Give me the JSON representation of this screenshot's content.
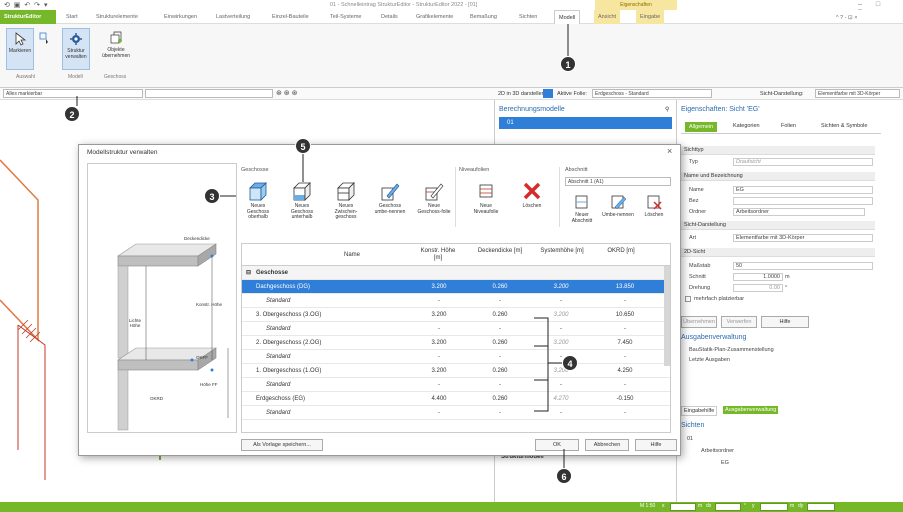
{
  "titlebar": {
    "quick_access": "⟲ ▣ ↶ ↷ ▾",
    "title": "01 - Schnelleintrag StrukturEditor - StrukturEditor 2022 - [01]",
    "context": "Eigenschaften",
    "win": "– □ ×",
    "help": "^ ? - ⊡ ×"
  },
  "tabs": {
    "app": "StrukturEditor",
    "start": "Start",
    "struktur": "Strukturelemente",
    "einwirk": "Einwirkungen",
    "last": "Lastverteilung",
    "einzel": "Einzel-Bauteile",
    "teil": "Teil-Systeme",
    "details": "Details",
    "grafik": "Grafikelemente",
    "bemassung": "Bemaßung",
    "sichten": "Sichten",
    "modell": "Modell",
    "ansicht": "Ansicht",
    "eingabe": "Eingabe"
  },
  "ribbon": {
    "markieren": "Markieren",
    "struktur": "Struktur verwalten",
    "objekte": "Objekte übernehmen",
    "g_auswahl": "Auswahl",
    "g_modell": "Modell",
    "g_geschoss": "Geschoss"
  },
  "toolbar": {
    "filter": "Alles markierbar",
    "show3d": "2D in 3D darstellen:",
    "aktive": "Aktive Folie:",
    "folie": "Erdgeschoss - Standard",
    "sichtdar": "Sicht-Darstellung:",
    "sichtwert": "Elementfarbe mit 3D-Körper"
  },
  "calc": {
    "title": "Berechnungsmodelle",
    "item": "01",
    "strukturmodell": "Strukturmodell"
  },
  "props": {
    "title": "Eigenschaften: Sicht 'EG'",
    "tab_allg": "Allgemein",
    "tab_kat": "Kategorien",
    "tab_fol": "Folien",
    "tab_sym": "Sichten & Symbole",
    "s_typ": "Sichttyp",
    "typ_l": "Typ",
    "typ_v": "Draufsicht",
    "s_name": "Name und Bezeichnung",
    "name_l": "Name",
    "name_v": "EG",
    "bez_l": "Bez",
    "ordner_l": "Ordner",
    "ordner_v": "Arbeitsordner",
    "s_sicht": "Sicht-Darstellung",
    "art_l": "Art",
    "art_v": "Elementfarbe mit 3D-Körper",
    "s_2d": "2D-Sicht",
    "mass_l": "Maßstab",
    "mass_v": "50",
    "schnitt_l": "Schnitt",
    "schnitt_v": "1.0000",
    "schnitt_u": "m",
    "dreh_l": "Drehung",
    "dreh_v": "0.00",
    "dreh_u": "°",
    "platz": "mehrfach platzierbar",
    "btn_ueber": "Übernehmen",
    "btn_verw": "Verwerfen",
    "btn_hilfe": "Hilfe",
    "ausgabe_title": "Ausgabenverwaltung",
    "ausgabe_1": "BauStatik-Plan-Zusammenstellung",
    "ausgabe_2": "Letzte Ausgaben",
    "tab_eingabehilfe": "Eingabehilfe",
    "tab_ausgabe": "Ausgabenverwaltung",
    "sichten_title": "Sichten",
    "tree_01": "01",
    "tree_ordner": "Arbeitsordner",
    "tree_eg": "EG"
  },
  "status": {
    "scale": "M 1:50",
    "x_l": "x",
    "x_v": "2.8572",
    "dx_l": "m",
    "dx": "dx",
    "dx_v": "106.45",
    "ang": "°",
    "y_l": "y",
    "y_v": "-0.0091",
    "dy": "dy",
    "dy_v": "2.7403",
    "m2": "m",
    "m3": "m"
  },
  "dialog": {
    "title": "Modellstruktur verwalten",
    "g_geschosse": "Geschosse",
    "g_niveau": "Niveaufolien",
    "g_abschnitt": "Abschnitt",
    "abschnitt_sel": "Abschnitt 1 (A1)",
    "b_oberhalb": "Neues Geschoss oberhalb",
    "b_unterhalb": "Neues Geschoss unterhalb",
    "b_zwischen": "Neues Zwischen-geschoss",
    "b_umbenennen": "Geschoss umbe-nennen",
    "b_folie": "Neue Geschoss-folie",
    "b_niveau": "Neue Niveaufolie",
    "b_loeschen": "Löschen",
    "b_abschnitt": "Neuer Abschnitt",
    "b_umbenennen2": "Umbe-nennen",
    "b_loeschen2": "Löschen",
    "d_deckendicke": "Deckendicke",
    "d_konstr": "Konstr. Höhe",
    "d_lichte": "Lichte Höhe",
    "d_okff": "OKFF",
    "d_hoheff": "Höhe FF",
    "d_okrd": "OKRD",
    "h_name": "Name",
    "h_konstr": "Konstr. Höhe [m]",
    "h_decken": "Deckendicke [m]",
    "h_system": "Systemhöhe [m]",
    "h_okrd": "OKRD [m]",
    "group": "Geschosse",
    "rows": [
      {
        "name": "Dachgeschoss (DG)",
        "k": "3.200",
        "d": "0.260",
        "s": "3.200",
        "o": "13.850"
      },
      {
        "name": "Standard",
        "k": "-",
        "d": "-",
        "s": "-",
        "o": "-"
      },
      {
        "name": "3. Obergeschoss (3.OG)",
        "k": "3.200",
        "d": "0.260",
        "s": "3.200",
        "o": "10.650"
      },
      {
        "name": "Standard",
        "k": "-",
        "d": "-",
        "s": "-",
        "o": "-"
      },
      {
        "name": "2. Obergeschoss (2.OG)",
        "k": "3.200",
        "d": "0.260",
        "s": "3.200",
        "o": "7.450"
      },
      {
        "name": "Standard",
        "k": "-",
        "d": "-",
        "s": "-",
        "o": "-"
      },
      {
        "name": "1. Obergeschoss (1.OG)",
        "k": "3.200",
        "d": "0.260",
        "s": "3.200",
        "o": "4.250"
      },
      {
        "name": "Standard",
        "k": "-",
        "d": "-",
        "s": "-",
        "o": "-"
      },
      {
        "name": "Erdgeschoss (EG)",
        "k": "4.400",
        "d": "0.260",
        "s": "4.270",
        "o": "-0.150"
      },
      {
        "name": "Standard",
        "k": "-",
        "d": "-",
        "s": "-",
        "o": "-"
      }
    ],
    "btn_vorlage": "Als Vorlage speichern...",
    "btn_ok": "OK",
    "btn_abbrechen": "Abbrechen",
    "btn_hilfe": "Hilfe"
  },
  "callouts": {
    "c1": "1",
    "c2": "2",
    "c3": "3",
    "c4": "4",
    "c5": "5",
    "c6": "6"
  }
}
